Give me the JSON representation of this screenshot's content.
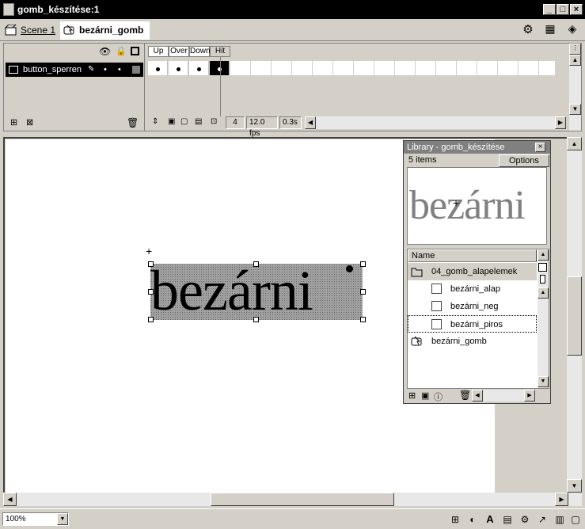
{
  "window": {
    "title": "gomb_készítése:1"
  },
  "scenebar": {
    "scene_label": "Scene 1",
    "symbol_label": "bezárni_gomb"
  },
  "timeline": {
    "frame_headers": [
      "Up",
      "Over",
      "Down",
      "Hit"
    ],
    "layer_name": "button_sperren",
    "frame_number": "4",
    "fps": "12.0 fps",
    "time": "0.3s"
  },
  "stage": {
    "text": "bezárni"
  },
  "library": {
    "title": "Library - gomb_készítése",
    "count": "5 items",
    "options_label": "Options",
    "preview_text": "bezárni",
    "column_name": "Name",
    "items": [
      {
        "label": "04_gomb_alapelemek",
        "type": "folder-icon"
      },
      {
        "label": "bezárni_alap",
        "type": "graphic-icon"
      },
      {
        "label": "bezárni_neg",
        "type": "graphic-icon"
      },
      {
        "label": "bezárni_piros",
        "type": "graphic-icon"
      },
      {
        "label": "bezárni_gomb",
        "type": "button-icon"
      }
    ]
  },
  "statusbar": {
    "zoom": "100%"
  }
}
